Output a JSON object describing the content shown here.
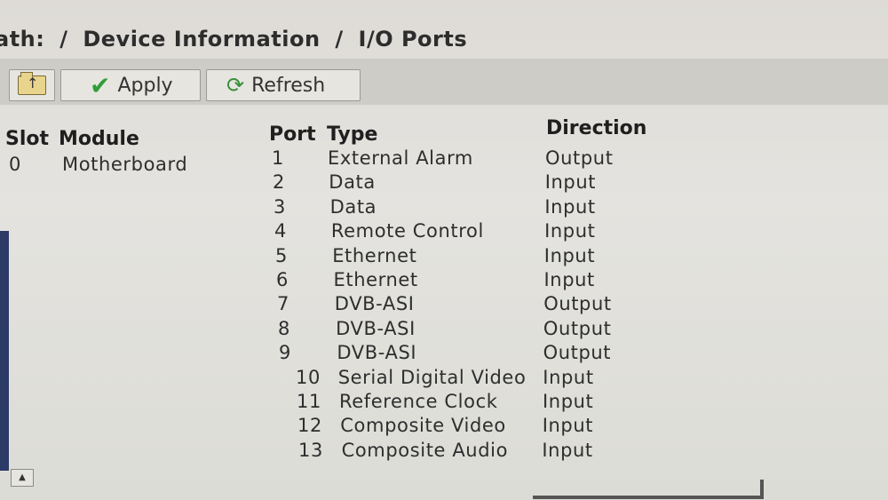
{
  "breadcrumb": {
    "prefix": "ath:",
    "sep1": "/",
    "part1": "Device Information",
    "sep2": "/",
    "part2": "I/O Ports"
  },
  "toolbar": {
    "folder_icon": "folder-up-icon",
    "apply_icon": "check-icon",
    "apply_label": "Apply",
    "refresh_icon": "refresh-icon",
    "refresh_label": "Refresh"
  },
  "slots": {
    "headers": {
      "slot": "Slot",
      "module": "Module"
    },
    "rows": [
      {
        "slot": "0",
        "module": "Motherboard"
      }
    ]
  },
  "ports": {
    "headers": {
      "port": "Port",
      "type": "Type",
      "direction": "Direction"
    },
    "rows": [
      {
        "port": "1",
        "type": "External Alarm",
        "direction": "Output"
      },
      {
        "port": "2",
        "type": "Data",
        "direction": "Input"
      },
      {
        "port": "3",
        "type": "Data",
        "direction": "Input"
      },
      {
        "port": "4",
        "type": "Remote Control",
        "direction": "Input"
      },
      {
        "port": "5",
        "type": "Ethernet",
        "direction": "Input"
      },
      {
        "port": "6",
        "type": "Ethernet",
        "direction": "Input"
      },
      {
        "port": "7",
        "type": "DVB-ASI",
        "direction": "Output"
      },
      {
        "port": "8",
        "type": "DVB-ASI",
        "direction": "Output"
      },
      {
        "port": "9",
        "type": "DVB-ASI",
        "direction": "Output"
      },
      {
        "port": "10",
        "type": "Serial Digital Video",
        "direction": "Input"
      },
      {
        "port": "11",
        "type": "Reference Clock",
        "direction": "Input"
      },
      {
        "port": "12",
        "type": "Composite Video",
        "direction": "Input"
      },
      {
        "port": "13",
        "type": "Composite Audio",
        "direction": "Input"
      }
    ]
  },
  "colors": {
    "check": "#2f9e3a",
    "window": "#e4e3df",
    "toolbar": "#cdccc6"
  }
}
